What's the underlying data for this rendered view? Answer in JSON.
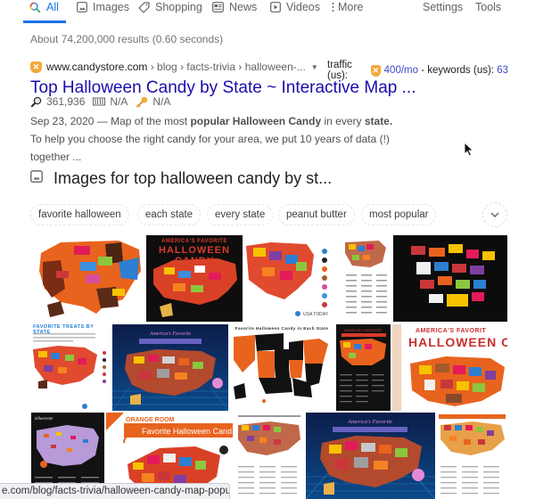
{
  "tabs": {
    "items": [
      {
        "label": "All",
        "icon": "search-icon",
        "active": true
      },
      {
        "label": "Images",
        "icon": "image-icon",
        "active": false
      },
      {
        "label": "Shopping",
        "icon": "tag-icon",
        "active": false
      },
      {
        "label": "News",
        "icon": "news-icon",
        "active": false
      },
      {
        "label": "Videos",
        "icon": "play-icon",
        "active": false
      },
      {
        "label": "More",
        "icon": "more-vert-icon",
        "active": false
      }
    ],
    "settings_label": "Settings",
    "tools_label": "Tools"
  },
  "result_stats": "About 74,200,000 results (0.60 seconds)",
  "result": {
    "domain": "www.candystore.com",
    "breadcrumbs": [
      " › blog",
      " › facts-trivia",
      " › halloween-..."
    ],
    "caret": "▼",
    "traffic_label": "traffic (us):",
    "traffic_value": "400/mo",
    "keywords_label": " - keywords (us): ",
    "keywords_value": "63",
    "title": "Top Halloween Candy by State ~ Interactive Map ...",
    "metrics": {
      "search_volume": "361,936",
      "book_value": "N/A",
      "key_value": "N/A"
    },
    "snippet": {
      "date": "Sep 23, 2020",
      "dash": " — Map of the most ",
      "bold1": "popular Halloween Candy",
      "mid1": " in every ",
      "bold2": "state.",
      "rest": " To help you choose the right candy for your area, we put 10 years of data (!) together ..."
    }
  },
  "images_section": {
    "title": "Images for top halloween candy by st...",
    "chips": [
      "favorite halloween",
      "each state",
      "every state",
      "peanut butter",
      "most popular"
    ],
    "thumbnails": [
      {
        "caption": "",
        "alt": "US map with candy bar logos on orange states"
      },
      {
        "caption": "AMERICA'S FAVORITE HALLOWEEN CANDY",
        "alt": "black background candy map"
      },
      {
        "caption": "",
        "alt": "colorful candy wrapper map with legend"
      },
      {
        "caption": "",
        "alt": "candy map with numbered list"
      },
      {
        "caption": "",
        "alt": "black background candy wrapper map"
      },
      {
        "caption": "FAVORITE TREATS BY STATE",
        "alt": "Influenster candy map"
      },
      {
        "caption": "America's Favorite Halloween Candy",
        "alt": "neon blue grid candy map"
      },
      {
        "caption": "Favorite Halloween Candy in Each State",
        "alt": "orange and black state map"
      },
      {
        "caption": "",
        "alt": "black poster candy map with list"
      },
      {
        "caption": "AMERICA'S FAVORITE HALLOWEEN CA",
        "alt": "white background candy map"
      },
      {
        "caption": "",
        "alt": "influenster purple candy map"
      },
      {
        "caption": "ORANGE ROOM Favorite Halloween Cand",
        "alt": "orange room candy map"
      },
      {
        "caption": "",
        "alt": "candy map with numbered list"
      },
      {
        "caption": "",
        "alt": "neon blue candy map"
      },
      {
        "caption": "",
        "alt": "candy map with orange header"
      }
    ]
  },
  "status_bar": "e.com/blog/facts-trivia/halloween-candy-map-popular/"
}
